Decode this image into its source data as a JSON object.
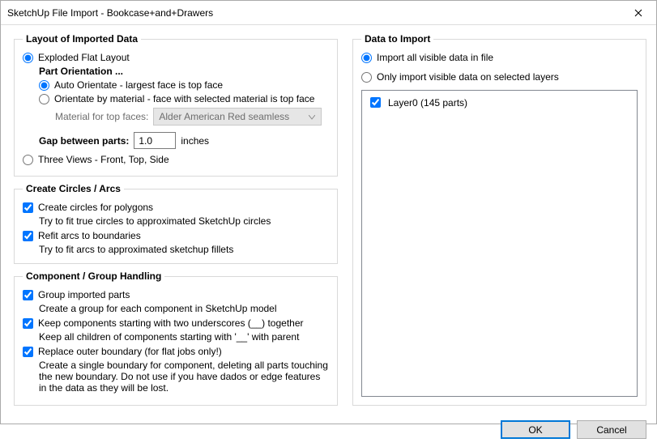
{
  "window": {
    "title": "SketchUp File Import - Bookcase+and+Drawers",
    "close_aria": "Close"
  },
  "layout": {
    "legend": "Layout of Imported Data",
    "exploded_label": "Exploded Flat Layout",
    "part_orientation": "Part Orientation ...",
    "auto_orient": "Auto Orientate - largest face is top face",
    "by_material": "Orientate by material - face with selected material is top face",
    "material_label": "Material for top faces:",
    "material_value": "Alder American Red seamless",
    "gap_label": "Gap between parts:",
    "gap_value": "1.0",
    "gap_units": "inches",
    "three_views": "Three Views - Front, Top, Side"
  },
  "circles": {
    "legend": "Create Circles / Arcs",
    "create_circles": "Create circles for polygons",
    "create_circles_hint": "Try to fit true circles to approximated SketchUp circles",
    "refit_arcs": "Refit arcs to boundaries",
    "refit_arcs_hint": "Try to fit arcs to approximated sketchup fillets"
  },
  "groups": {
    "legend": "Component / Group Handling",
    "group_imported": "Group imported parts",
    "group_imported_hint": "Create a group for each component in SketchUp model",
    "keep_underscore": "Keep components starting with two underscores (__) together",
    "keep_underscore_hint": "Keep all children of components starting with '__' with parent",
    "replace_boundary": "Replace outer boundary (for flat jobs only!)",
    "replace_boundary_hint": "Create a single boundary for component, deleting all parts touching the new boundary. Do not use if you have dados or edge features in the data as they will be lost."
  },
  "data": {
    "legend": "Data to Import",
    "import_all": "Import all visible data in file",
    "import_selected": "Only import visible data on selected layers",
    "layers": [
      {
        "label": "Layer0 (145 parts)",
        "checked": true
      }
    ]
  },
  "buttons": {
    "ok": "OK",
    "cancel": "Cancel"
  }
}
